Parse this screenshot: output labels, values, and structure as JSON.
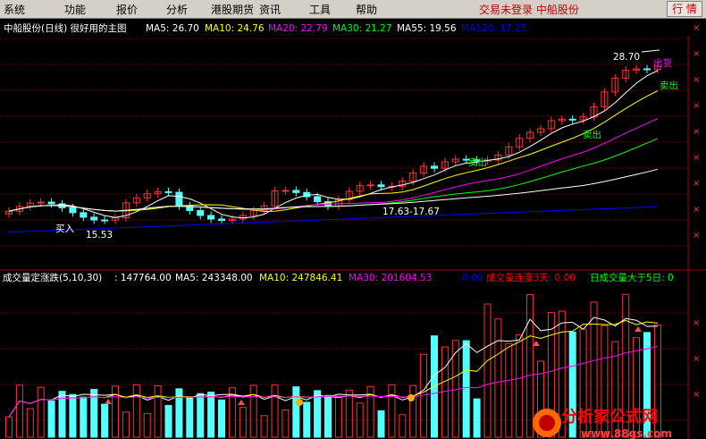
{
  "menu": {
    "items": [
      "系统",
      "功能",
      "报价",
      "分析",
      "港股期货",
      "资讯",
      "工具",
      "帮助"
    ],
    "status": "交易未登录  中船股份",
    "quote_button": "行 情"
  },
  "main_panel": {
    "title": "中船股份(日线) 很好用的主图",
    "ma_labels": [
      {
        "text": "MA5: 26.70",
        "color": "#ffffff"
      },
      {
        "text": "MA10: 24.76",
        "color": "#ffff00"
      },
      {
        "text": "MA20: 22.79",
        "color": "#ff00ff"
      },
      {
        "text": "MA30: 21.27",
        "color": "#00ff00"
      },
      {
        "text": "MA55: 19.56",
        "color": "#ffffff"
      },
      {
        "text": "MA120: 17.25",
        "color": "#0000ff"
      }
    ],
    "annotations": {
      "high": "28.70",
      "sell_out": "出货",
      "sell": "卖出",
      "buy": "买入",
      "low": "15.53",
      "range": "17.63-17.67"
    },
    "y_axis_marks": [
      "×",
      "×",
      "×",
      "×",
      "×",
      "×",
      "×",
      "×",
      "×",
      "×",
      "×",
      "×"
    ]
  },
  "volume_panel": {
    "title": "成交量定涨跌(5,10,30)",
    "labels": [
      {
        "text": ": 147764.00",
        "color": "#ffffff"
      },
      {
        "text": "MA5: 243348.00",
        "color": "#ffffff"
      },
      {
        "text": "MA10: 247846.41",
        "color": "#ffff00"
      },
      {
        "text": "MA30: 201604.53",
        "color": "#ff00ff"
      },
      {
        "text": ": 0.00",
        "color": "#0000ff"
      },
      {
        "text": "成交量连涨3天: 0.00",
        "color": "#ff0000"
      },
      {
        "text": "日成交量大于5日: 0",
        "color": "#00ff00"
      }
    ]
  },
  "watermark": {
    "title": "分析家公式网",
    "url": "www.88gs.com"
  },
  "colors": {
    "up": "#ff3232",
    "down": "#54ffff",
    "grid": "#8b0000",
    "ma5": "#ffffff",
    "ma10": "#ffff00",
    "ma20": "#ff00ff",
    "ma30": "#00ff00",
    "ma55": "#ffffff",
    "ma120": "#0000ff"
  }
}
